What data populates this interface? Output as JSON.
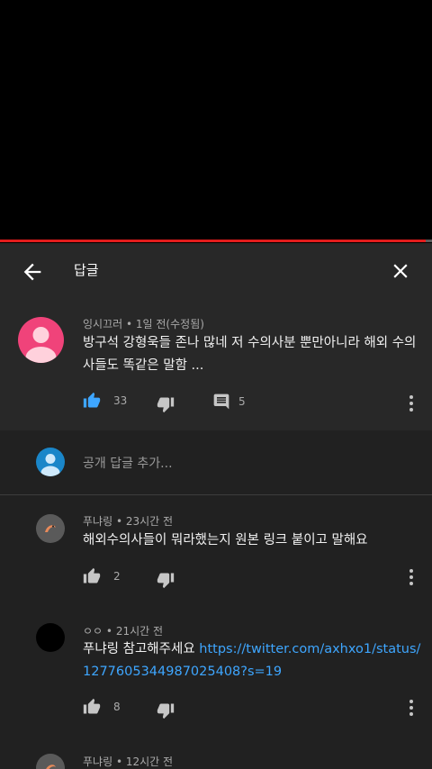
{
  "video": {
    "progress": 0.985
  },
  "header": {
    "title": "답글",
    "back_icon": "arrow-left-icon",
    "close_icon": "close-icon"
  },
  "parent_comment": {
    "author": "잉시끄러",
    "time": "1일 전(수정됨)",
    "text_line1": "방구석 강형욱들 존나 많네 저 수의사분 뿐만아니라 해외 수의",
    "text_line2": "사들도 똑같은 말함 ...",
    "likes": "33",
    "replies": "5",
    "avatar_color": "#f0437a"
  },
  "add_reply": {
    "placeholder": "공개 답글 추가...",
    "avatar_color": "#1a86c9"
  },
  "replies": [
    {
      "author": "푸냐링",
      "time": "23시간 전",
      "text_line1": "해외수의사들이 뭐라했는지 원본 링크 붙이고 말해요",
      "likes": "2"
    },
    {
      "author": "ㅇㅇ",
      "time": "21시간 전",
      "text_prefix": "푸냐링 참고해주세요 ",
      "link_line1": "https://twitter.com/axhxo1/status/",
      "link_line2": "1277605344987025408?s=19",
      "likes": "8"
    },
    {
      "author": "푸냐링",
      "time": "12시간 전"
    }
  ],
  "colors": {
    "accent_like": "#3ea6ff",
    "link": "#3ea6ff",
    "progress": "#e21c1c"
  }
}
